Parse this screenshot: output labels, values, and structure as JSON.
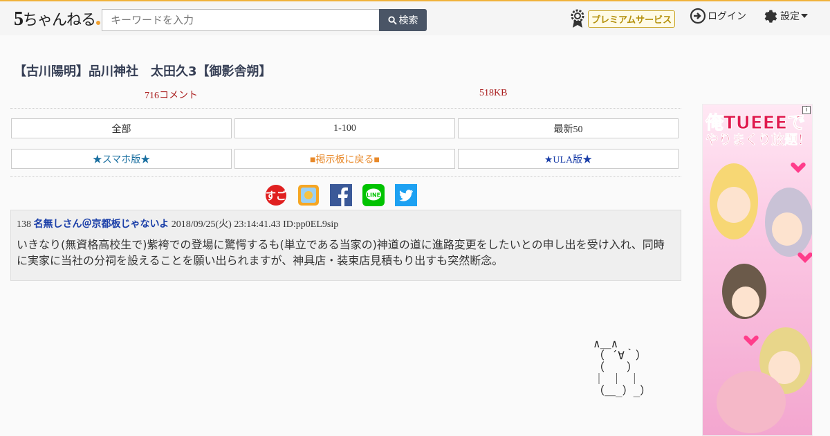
{
  "header": {
    "logo_text": "ちゃんねる",
    "logo_number": "5",
    "search_placeholder": "キーワードを入力",
    "search_button": "検索",
    "premium_label": "プレミアムサービス",
    "login_label": "ログイン",
    "settings_label": "設定"
  },
  "thread": {
    "title": "【古川陽明】品川神社　太田久3【御影舎朔】",
    "comments": "716コメント",
    "size": "518KB"
  },
  "nav": {
    "row1": [
      "全部",
      "1-100",
      "最新50"
    ],
    "row2": [
      "★スマホ版★",
      "■掲示板に戻る■",
      "★ULA版★"
    ]
  },
  "social_icons": [
    "sugoi-icon",
    "app-icon",
    "facebook-icon",
    "line-icon",
    "twitter-icon"
  ],
  "post": {
    "number": "138",
    "name": "名無しさん＠京都板じゃないよ",
    "datetime": "2018/09/25(火) 23:14:41.43",
    "id": "ID:pp0EL9sip",
    "body": "いきなり(無資格高校生で)紫袴での登場に驚愕するも(単立である当家の)神道の道に進路変更をしたいとの申し出を受け入れ、同時に実家に当社の分祠を設えることを願い出られますが、神具店・装束店見積もり出すも突然断念。"
  },
  "ad": {
    "line1": "俺TUEEEで",
    "line2": "やりまくり放題！"
  },
  "ascii_art": "∧＿∧\n（ ´∀｀）\n（　　）\n｜ ｜ ｜\n（＿_）_）",
  "colors": {
    "accent": "#f0b23a",
    "title": "#363f55",
    "meta": "#aa1f1f",
    "name": "#1a3ea8",
    "nav_teal": "#1a6fa0",
    "nav_orange": "#e8892a",
    "nav_navy": "#1a3ea8"
  }
}
